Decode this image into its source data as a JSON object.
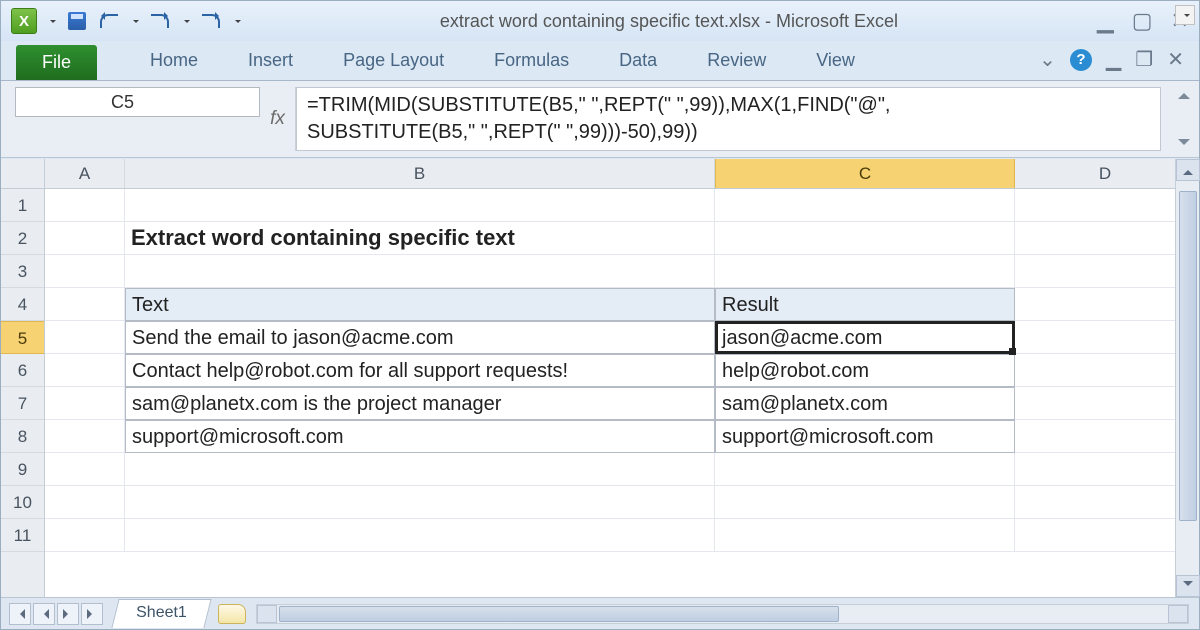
{
  "window": {
    "title": "extract word containing specific text.xlsx  -  Microsoft Excel"
  },
  "ribbon": {
    "file": "File",
    "tabs": [
      "Home",
      "Insert",
      "Page Layout",
      "Formulas",
      "Data",
      "Review",
      "View"
    ]
  },
  "namebox": "C5",
  "fx_label": "fx",
  "formula_line1": "=TRIM(MID(SUBSTITUTE(B5,\" \",REPT(\" \",99)),MAX(1,FIND(\"@\",",
  "formula_line2": "SUBSTITUTE(B5,\" \",REPT(\" \",99)))-50),99))",
  "columns": [
    "A",
    "B",
    "C",
    "D"
  ],
  "row_numbers": [
    "1",
    "2",
    "3",
    "4",
    "5",
    "6",
    "7",
    "8",
    "9",
    "10",
    "11"
  ],
  "selected_row": "5",
  "selected_col": "C",
  "title_cell": "Extract word containing specific text",
  "table": {
    "headers": {
      "text": "Text",
      "result": "Result"
    },
    "rows": [
      {
        "text": "Send the email to jason@acme.com",
        "result": "jason@acme.com"
      },
      {
        "text": "Contact help@robot.com for all support requests!",
        "result": "help@robot.com"
      },
      {
        "text": "sam@planetx.com is the project manager",
        "result": "sam@planetx.com"
      },
      {
        "text": "support@microsoft.com",
        "result": "support@microsoft.com"
      }
    ]
  },
  "sheet_tab": "Sheet1"
}
